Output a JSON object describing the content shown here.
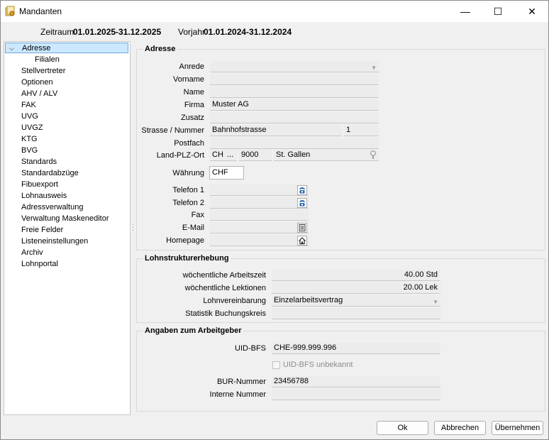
{
  "window": {
    "title": "Mandanten",
    "minimize": "—",
    "maximize": "☐",
    "close": "✕"
  },
  "period": {
    "zeitraum_label": "Zeitraum",
    "zeitraum_value": "01.01.2025-31.12.2025",
    "vorjahr_label": "Vorjahr",
    "vorjahr_value": "01.01.2024-31.12.2024"
  },
  "nav": {
    "selected": "Adresse",
    "items": [
      "Filialen",
      "Stellvertreter",
      "Optionen",
      "AHV / ALV",
      "FAK",
      "UVG",
      "UVGZ",
      "KTG",
      "BVG",
      "Standards",
      "Standardabzüge",
      "Fibuexport",
      "Lohnausweis",
      "Adressverwaltung",
      "Verwaltung Maskeneditor",
      "Freie Felder",
      "Listeneinstellungen",
      "Archiv",
      "Lohnportal"
    ]
  },
  "adresse": {
    "title": "Adresse",
    "labels": {
      "anrede": "Anrede",
      "vorname": "Vorname",
      "name": "Name",
      "firma": "Firma",
      "zusatz": "Zusatz",
      "strasse": "Strasse / Nummer",
      "postfach": "Postfach",
      "land": "Land-PLZ-Ort",
      "waehrung": "Währung",
      "telefon1": "Telefon 1",
      "telefon2": "Telefon 2",
      "fax": "Fax",
      "email": "E-Mail",
      "homepage": "Homepage"
    },
    "values": {
      "anrede": "",
      "vorname": "",
      "name": "",
      "firma": "Muster AG",
      "zusatz": "",
      "strasse": "Bahnhofstrasse",
      "nummer": "1",
      "postfach": "",
      "land": "CH",
      "land_more": "...",
      "plz": "9000",
      "ort": "St. Gallen",
      "waehrung": "CHF",
      "telefon1": "",
      "telefon2": "",
      "fax": "",
      "email": "",
      "homepage": ""
    }
  },
  "lohnstruktur": {
    "title": "Lohnstrukturerhebung",
    "labels": {
      "arbeitszeit": "wöchentliche Arbeitszeit",
      "lektionen": "wöchentliche Lektionen",
      "lohnvereinbarung": "Lohnvereinbarung",
      "buchungskreis": "Statistik Buchungskreis"
    },
    "values": {
      "arbeitszeit": "40.00 Std",
      "lektionen": "20.00 Lek",
      "lohnvereinbarung": "Einzelarbeitsvertrag",
      "buchungskreis": ""
    }
  },
  "arbeitgeber": {
    "title": "Angaben zum Arbeitgeber",
    "labels": {
      "uid": "UID-BFS",
      "uid_unbekannt": "UID-BFS unbekannt",
      "bur": "BUR-Nummer",
      "intern": "Interne Nummer"
    },
    "values": {
      "uid": "CHE-999.999.996",
      "uid_unbekannt_checked": false,
      "bur": "23456788",
      "intern": ""
    }
  },
  "buttons": {
    "ok": "Ok",
    "abbrechen": "Abbrechen",
    "uebernehmen": "Übernehmen"
  },
  "colors": {
    "selection": "#cce8ff",
    "selection_border": "#6fa8dc",
    "phone_icon": "#1a5fa8"
  }
}
